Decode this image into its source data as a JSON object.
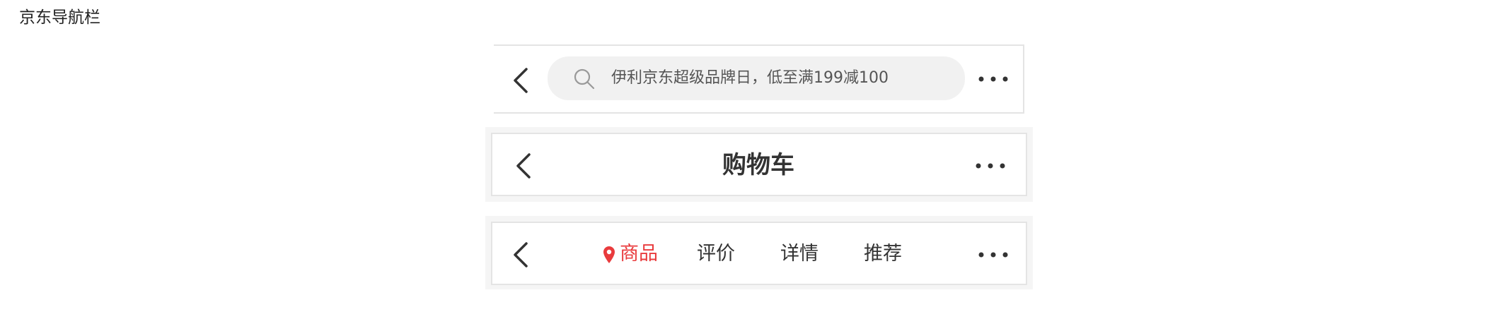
{
  "page": {
    "title": "京东导航栏"
  },
  "search_bar": {
    "back_icon": "chevron-left-icon",
    "search_icon": "search-icon",
    "placeholder": "伊利京东超级品牌日，低至满199减100",
    "more_icon": "more-horizontal-icon"
  },
  "cart_bar": {
    "back_icon": "chevron-left-icon",
    "title": "购物车",
    "more_icon": "more-horizontal-icon"
  },
  "product_bar": {
    "back_icon": "chevron-left-icon",
    "tabs": [
      {
        "label": "商品",
        "active": true,
        "icon": "location-pin-icon"
      },
      {
        "label": "评价",
        "active": false
      },
      {
        "label": "详情",
        "active": false
      },
      {
        "label": "推荐",
        "active": false
      }
    ],
    "more_icon": "more-horizontal-icon"
  },
  "colors": {
    "accent": "#e93b3d",
    "text": "#333333",
    "search_bg": "#f1f1f1",
    "border": "#e4e4e4",
    "outer_bg": "#f5f5f5"
  }
}
